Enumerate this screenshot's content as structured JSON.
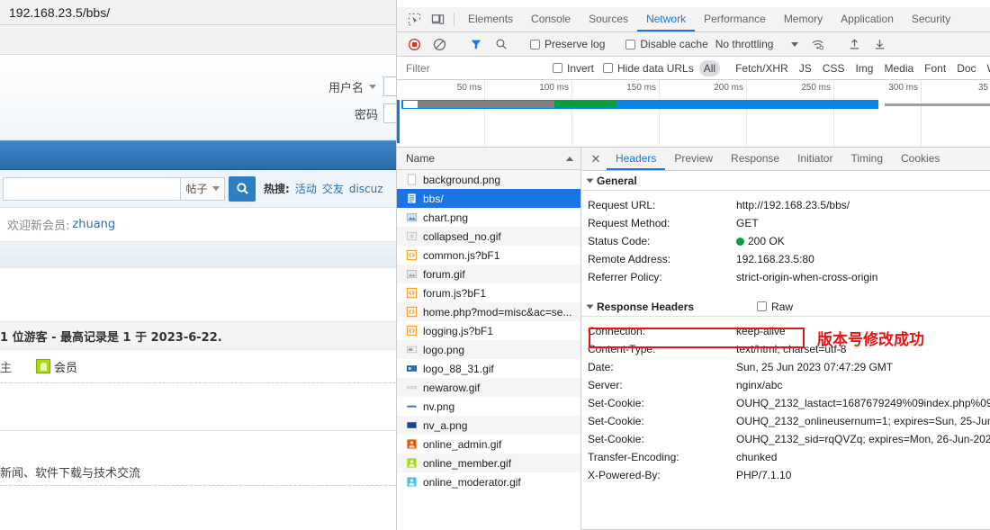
{
  "browser": {
    "url": "192.168.23.5/bbs/"
  },
  "forum": {
    "login": {
      "username_label": "用户名",
      "password_label": "密码"
    },
    "search": {
      "scope_label": "帖子",
      "hot_label": "热搜:",
      "hot_links": [
        "活动",
        "交友",
        "discuz"
      ]
    },
    "welcome": {
      "label": "欢迎新会员:",
      "user": "zhuang"
    },
    "stats": "1 位游客 - 最高记录是 1 于 2023-6-22.",
    "member_label": "会员",
    "member_prefix": "主",
    "description": "新闻、软件下载与技术交流"
  },
  "devtools": {
    "tabs": [
      {
        "label": "Elements",
        "active": false
      },
      {
        "label": "Console",
        "active": false
      },
      {
        "label": "Sources",
        "active": false
      },
      {
        "label": "Network",
        "active": true
      },
      {
        "label": "Performance",
        "active": false
      },
      {
        "label": "Memory",
        "active": false
      },
      {
        "label": "Application",
        "active": false
      },
      {
        "label": "Security",
        "active": false
      }
    ],
    "toolbar": {
      "preserve_log": "Preserve log",
      "disable_cache": "Disable cache",
      "throttling": "No throttling"
    },
    "filterbar": {
      "filter_placeholder": "Filter",
      "invert": "Invert",
      "hide_data_urls": "Hide data URLs",
      "types": [
        {
          "label": "All",
          "active": true
        },
        {
          "label": "Fetch/XHR",
          "active": false
        },
        {
          "label": "JS",
          "active": false
        },
        {
          "label": "CSS",
          "active": false
        },
        {
          "label": "Img",
          "active": false
        },
        {
          "label": "Media",
          "active": false
        },
        {
          "label": "Font",
          "active": false
        },
        {
          "label": "Doc",
          "active": false
        },
        {
          "label": "WS",
          "active": false
        }
      ]
    },
    "overview": {
      "ticks": [
        "50 ms",
        "100 ms",
        "150 ms",
        "200 ms",
        "250 ms",
        "300 ms",
        "35"
      ]
    },
    "requests": {
      "column_name": "Name",
      "rows": [
        {
          "name": "background.png",
          "icon": "doc-plain-icon",
          "selected": false
        },
        {
          "name": "bbs/",
          "icon": "document-icon",
          "selected": true
        },
        {
          "name": "chart.png",
          "icon": "image-icon",
          "selected": false
        },
        {
          "name": "collapsed_no.gif",
          "icon": "image-icon",
          "selected": false
        },
        {
          "name": "common.js?bF1",
          "icon": "script-icon",
          "selected": false
        },
        {
          "name": "forum.gif",
          "icon": "image-icon",
          "selected": false
        },
        {
          "name": "forum.js?bF1",
          "icon": "script-icon",
          "selected": false
        },
        {
          "name": "home.php?mod=misc&ac=se...",
          "icon": "script-icon",
          "selected": false
        },
        {
          "name": "logging.js?bF1",
          "icon": "script-icon",
          "selected": false
        },
        {
          "name": "logo.png",
          "icon": "image-icon",
          "selected": false
        },
        {
          "name": "logo_88_31.gif",
          "icon": "image-icon",
          "selected": false
        },
        {
          "name": "newarow.gif",
          "icon": "image-icon",
          "selected": false
        },
        {
          "name": "nv.png",
          "icon": "image-icon",
          "selected": false
        },
        {
          "name": "nv_a.png",
          "icon": "image-icon",
          "selected": false
        },
        {
          "name": "online_admin.gif",
          "icon": "image-icon",
          "selected": false
        },
        {
          "name": "online_member.gif",
          "icon": "image-icon",
          "selected": false
        },
        {
          "name": "online_moderator.gif",
          "icon": "image-icon",
          "selected": false
        }
      ]
    },
    "detail": {
      "tabs": [
        {
          "label": "Headers",
          "active": true
        },
        {
          "label": "Preview",
          "active": false
        },
        {
          "label": "Response",
          "active": false
        },
        {
          "label": "Initiator",
          "active": false
        },
        {
          "label": "Timing",
          "active": false
        },
        {
          "label": "Cookies",
          "active": false
        }
      ],
      "general": {
        "title": "General",
        "rows": [
          {
            "key": "Request URL:",
            "value": "http://192.168.23.5/bbs/"
          },
          {
            "key": "Request Method:",
            "value": "GET"
          },
          {
            "key": "Status Code:",
            "value": "200 OK",
            "dot": true
          },
          {
            "key": "Remote Address:",
            "value": "192.168.23.5:80"
          },
          {
            "key": "Referrer Policy:",
            "value": "strict-origin-when-cross-origin"
          }
        ]
      },
      "response_headers": {
        "title": "Response Headers",
        "raw_label": "Raw",
        "rows": [
          {
            "key": "Connection:",
            "value": "keep-alive"
          },
          {
            "key": "Content-Type:",
            "value": "text/html; charset=utf-8"
          },
          {
            "key": "Date:",
            "value": "Sun, 25 Jun 2023 07:47:29 GMT"
          },
          {
            "key": "Server:",
            "value": "nginx/abc"
          },
          {
            "key": "Set-Cookie:",
            "value": "OUHQ_2132_lastact=1687679249%09index.php%09"
          },
          {
            "key": "Set-Cookie:",
            "value": "OUHQ_2132_onlineusernum=1; expires=Sun, 25-Jun"
          },
          {
            "key": "Set-Cookie:",
            "value": "OUHQ_2132_sid=rqQVZq; expires=Mon, 26-Jun-202"
          },
          {
            "key": "Transfer-Encoding:",
            "value": "chunked"
          },
          {
            "key": "X-Powered-By:",
            "value": "PHP/7.1.10"
          }
        ]
      }
    },
    "annotation": {
      "text": "版本号修改成功",
      "color": "#ee1111"
    }
  }
}
